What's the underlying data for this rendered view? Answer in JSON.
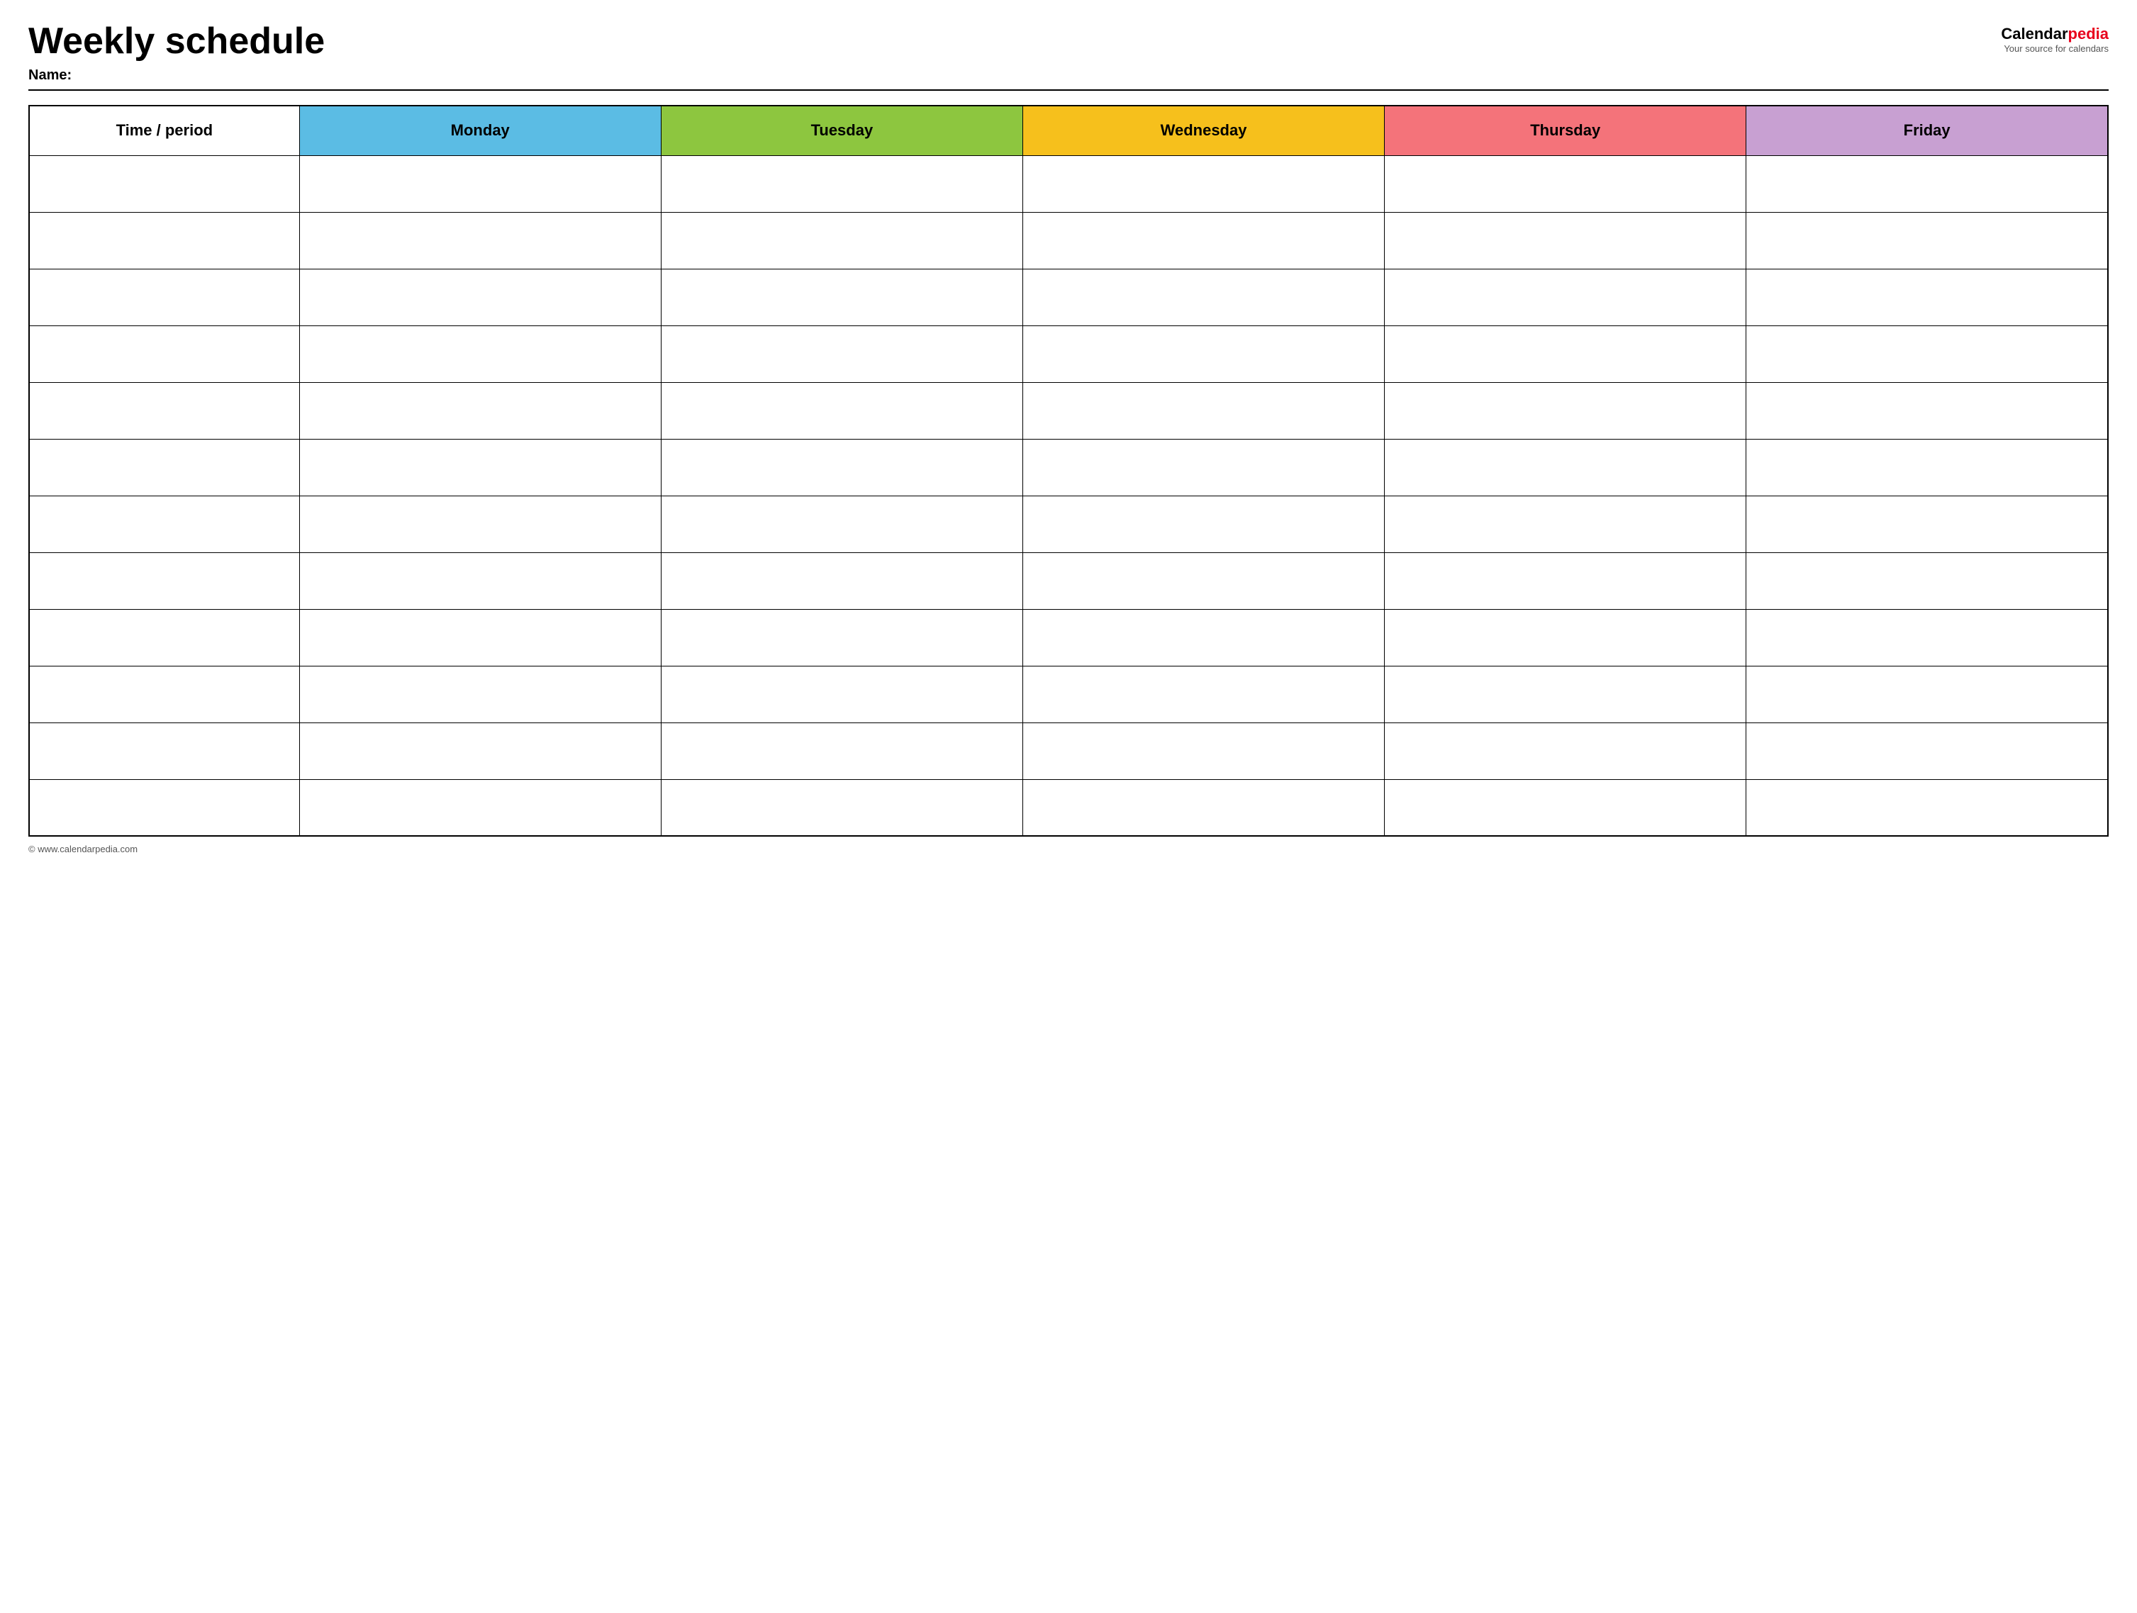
{
  "header": {
    "title": "Weekly schedule",
    "name_label": "Name:",
    "logo": {
      "text_calendar": "Calendar",
      "text_pedia": "pedia",
      "tagline": "Your source for calendars"
    }
  },
  "table": {
    "columns": [
      {
        "id": "time",
        "label": "Time / period",
        "color": "#ffffff"
      },
      {
        "id": "monday",
        "label": "Monday",
        "color": "#5bbce4"
      },
      {
        "id": "tuesday",
        "label": "Tuesday",
        "color": "#8dc63f"
      },
      {
        "id": "wednesday",
        "label": "Wednesday",
        "color": "#f6c01c"
      },
      {
        "id": "thursday",
        "label": "Thursday",
        "color": "#f4737a"
      },
      {
        "id": "friday",
        "label": "Friday",
        "color": "#c8a0d2"
      }
    ],
    "rows": 12
  },
  "footer": {
    "copyright": "© www.calendarpedia.com"
  }
}
